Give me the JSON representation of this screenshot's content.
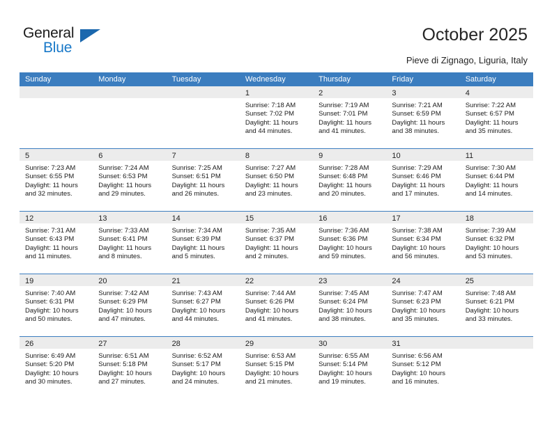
{
  "brand": {
    "name_top": "General",
    "name_bottom": "Blue",
    "flag_color": "#1b68ae",
    "blue_color": "#1878c8"
  },
  "header": {
    "title": "October 2025",
    "location": "Pieve di Zignago, Liguria, Italy"
  },
  "theme": {
    "header_row_bg": "#3b7dbf",
    "day_band_bg": "#ececec",
    "cell_bg": "#ffffff",
    "separator": "#3b7dbf"
  },
  "weekdays": [
    "Sunday",
    "Monday",
    "Tuesday",
    "Wednesday",
    "Thursday",
    "Friday",
    "Saturday"
  ],
  "weeks": [
    [
      {
        "day": "",
        "sunrise": "",
        "sunset": "",
        "daylight": "",
        "empty": true
      },
      {
        "day": "",
        "sunrise": "",
        "sunset": "",
        "daylight": "",
        "empty": true
      },
      {
        "day": "",
        "sunrise": "",
        "sunset": "",
        "daylight": "",
        "empty": true
      },
      {
        "day": "1",
        "sunrise": "Sunrise: 7:18 AM",
        "sunset": "Sunset: 7:02 PM",
        "daylight": "Daylight: 11 hours and 44 minutes."
      },
      {
        "day": "2",
        "sunrise": "Sunrise: 7:19 AM",
        "sunset": "Sunset: 7:01 PM",
        "daylight": "Daylight: 11 hours and 41 minutes."
      },
      {
        "day": "3",
        "sunrise": "Sunrise: 7:21 AM",
        "sunset": "Sunset: 6:59 PM",
        "daylight": "Daylight: 11 hours and 38 minutes."
      },
      {
        "day": "4",
        "sunrise": "Sunrise: 7:22 AM",
        "sunset": "Sunset: 6:57 PM",
        "daylight": "Daylight: 11 hours and 35 minutes."
      }
    ],
    [
      {
        "day": "5",
        "sunrise": "Sunrise: 7:23 AM",
        "sunset": "Sunset: 6:55 PM",
        "daylight": "Daylight: 11 hours and 32 minutes."
      },
      {
        "day": "6",
        "sunrise": "Sunrise: 7:24 AM",
        "sunset": "Sunset: 6:53 PM",
        "daylight": "Daylight: 11 hours and 29 minutes."
      },
      {
        "day": "7",
        "sunrise": "Sunrise: 7:25 AM",
        "sunset": "Sunset: 6:51 PM",
        "daylight": "Daylight: 11 hours and 26 minutes."
      },
      {
        "day": "8",
        "sunrise": "Sunrise: 7:27 AM",
        "sunset": "Sunset: 6:50 PM",
        "daylight": "Daylight: 11 hours and 23 minutes."
      },
      {
        "day": "9",
        "sunrise": "Sunrise: 7:28 AM",
        "sunset": "Sunset: 6:48 PM",
        "daylight": "Daylight: 11 hours and 20 minutes."
      },
      {
        "day": "10",
        "sunrise": "Sunrise: 7:29 AM",
        "sunset": "Sunset: 6:46 PM",
        "daylight": "Daylight: 11 hours and 17 minutes."
      },
      {
        "day": "11",
        "sunrise": "Sunrise: 7:30 AM",
        "sunset": "Sunset: 6:44 PM",
        "daylight": "Daylight: 11 hours and 14 minutes."
      }
    ],
    [
      {
        "day": "12",
        "sunrise": "Sunrise: 7:31 AM",
        "sunset": "Sunset: 6:43 PM",
        "daylight": "Daylight: 11 hours and 11 minutes."
      },
      {
        "day": "13",
        "sunrise": "Sunrise: 7:33 AM",
        "sunset": "Sunset: 6:41 PM",
        "daylight": "Daylight: 11 hours and 8 minutes."
      },
      {
        "day": "14",
        "sunrise": "Sunrise: 7:34 AM",
        "sunset": "Sunset: 6:39 PM",
        "daylight": "Daylight: 11 hours and 5 minutes."
      },
      {
        "day": "15",
        "sunrise": "Sunrise: 7:35 AM",
        "sunset": "Sunset: 6:37 PM",
        "daylight": "Daylight: 11 hours and 2 minutes."
      },
      {
        "day": "16",
        "sunrise": "Sunrise: 7:36 AM",
        "sunset": "Sunset: 6:36 PM",
        "daylight": "Daylight: 10 hours and 59 minutes."
      },
      {
        "day": "17",
        "sunrise": "Sunrise: 7:38 AM",
        "sunset": "Sunset: 6:34 PM",
        "daylight": "Daylight: 10 hours and 56 minutes."
      },
      {
        "day": "18",
        "sunrise": "Sunrise: 7:39 AM",
        "sunset": "Sunset: 6:32 PM",
        "daylight": "Daylight: 10 hours and 53 minutes."
      }
    ],
    [
      {
        "day": "19",
        "sunrise": "Sunrise: 7:40 AM",
        "sunset": "Sunset: 6:31 PM",
        "daylight": "Daylight: 10 hours and 50 minutes."
      },
      {
        "day": "20",
        "sunrise": "Sunrise: 7:42 AM",
        "sunset": "Sunset: 6:29 PM",
        "daylight": "Daylight: 10 hours and 47 minutes."
      },
      {
        "day": "21",
        "sunrise": "Sunrise: 7:43 AM",
        "sunset": "Sunset: 6:27 PM",
        "daylight": "Daylight: 10 hours and 44 minutes."
      },
      {
        "day": "22",
        "sunrise": "Sunrise: 7:44 AM",
        "sunset": "Sunset: 6:26 PM",
        "daylight": "Daylight: 10 hours and 41 minutes."
      },
      {
        "day": "23",
        "sunrise": "Sunrise: 7:45 AM",
        "sunset": "Sunset: 6:24 PM",
        "daylight": "Daylight: 10 hours and 38 minutes."
      },
      {
        "day": "24",
        "sunrise": "Sunrise: 7:47 AM",
        "sunset": "Sunset: 6:23 PM",
        "daylight": "Daylight: 10 hours and 35 minutes."
      },
      {
        "day": "25",
        "sunrise": "Sunrise: 7:48 AM",
        "sunset": "Sunset: 6:21 PM",
        "daylight": "Daylight: 10 hours and 33 minutes."
      }
    ],
    [
      {
        "day": "26",
        "sunrise": "Sunrise: 6:49 AM",
        "sunset": "Sunset: 5:20 PM",
        "daylight": "Daylight: 10 hours and 30 minutes."
      },
      {
        "day": "27",
        "sunrise": "Sunrise: 6:51 AM",
        "sunset": "Sunset: 5:18 PM",
        "daylight": "Daylight: 10 hours and 27 minutes."
      },
      {
        "day": "28",
        "sunrise": "Sunrise: 6:52 AM",
        "sunset": "Sunset: 5:17 PM",
        "daylight": "Daylight: 10 hours and 24 minutes."
      },
      {
        "day": "29",
        "sunrise": "Sunrise: 6:53 AM",
        "sunset": "Sunset: 5:15 PM",
        "daylight": "Daylight: 10 hours and 21 minutes."
      },
      {
        "day": "30",
        "sunrise": "Sunrise: 6:55 AM",
        "sunset": "Sunset: 5:14 PM",
        "daylight": "Daylight: 10 hours and 19 minutes."
      },
      {
        "day": "31",
        "sunrise": "Sunrise: 6:56 AM",
        "sunset": "Sunset: 5:12 PM",
        "daylight": "Daylight: 10 hours and 16 minutes."
      },
      {
        "day": "",
        "sunrise": "",
        "sunset": "",
        "daylight": "",
        "empty": true
      }
    ]
  ]
}
